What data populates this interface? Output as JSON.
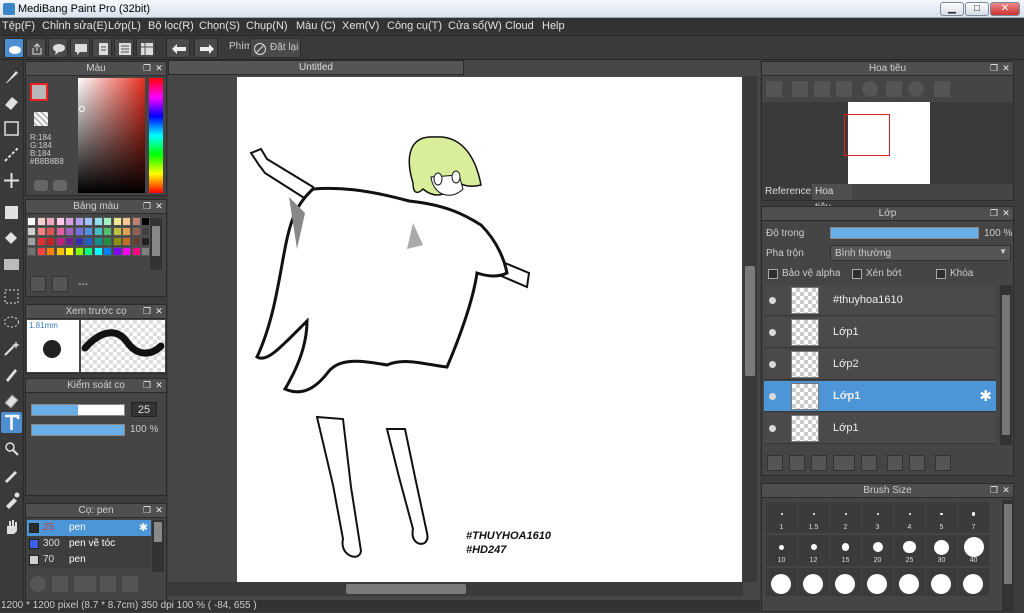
{
  "app": {
    "title": "MediBang Paint Pro (32bit)"
  },
  "window_controls": {
    "minimize": "▁",
    "maximize": "□",
    "close": "✕"
  },
  "menu": [
    "Tệp(F)",
    "Chỉnh sửa(E)",
    "Lớp(L)",
    "Bộ lọc(R)",
    "Chọn(S)",
    "Chụp(N)",
    "Màu (C)",
    "Xem(V)",
    "Công cụ(T)",
    "Cửa sổ(W)",
    "Cloud",
    "Help"
  ],
  "toolbar": {
    "shortcut_label": "Phím",
    "reset_label": "Đặt lại"
  },
  "color_panel": {
    "title": "Màu",
    "r": "R:184",
    "g": "G:184",
    "b": "B:184",
    "hex": "#B8B8B8",
    "primary_color": "#b8b8b8"
  },
  "palette_panel": {
    "title": "Bảng màu",
    "footer_text": "---",
    "colors": [
      "#ffffff",
      "#f6d0d0",
      "#f0a8c0",
      "#ffc8e8",
      "#d8a0e0",
      "#b0a0f0",
      "#a0c0ff",
      "#90e0f0",
      "#a0f0c0",
      "#f0e890",
      "#f8c890",
      "#c08070",
      "#000000",
      "#d0d0d0",
      "#f08080",
      "#e05050",
      "#e060a0",
      "#a060c0",
      "#7070e0",
      "#5090e0",
      "#40c0c0",
      "#50c070",
      "#c0c040",
      "#e0a050",
      "#906050",
      "#404040",
      "#a0a0a0",
      "#e03030",
      "#c02020",
      "#c02080",
      "#702090",
      "#3030b0",
      "#2060c0",
      "#109090",
      "#209040",
      "#909010",
      "#c07020",
      "#604030",
      "#202020",
      "#707070",
      "#ff4040",
      "#ff8000",
      "#ffc000",
      "#ffff00",
      "#80ff00",
      "#00ff80",
      "#00ffff",
      "#0080ff",
      "#8000ff",
      "#ff00ff",
      "#ff0080",
      "#808080"
    ]
  },
  "brush_preview": {
    "title": "Xem trước cọ",
    "size": "1.81mm"
  },
  "brush_control": {
    "title": "Kiểm soát cọ",
    "size_value": "25",
    "opacity_value": "100 %",
    "size_fraction": 0.5,
    "opacity_fraction": 1.0
  },
  "brush_list": {
    "title": "Cọ: pen",
    "items": [
      {
        "size": "25",
        "name": "pen",
        "color": "#2b2b2b",
        "selected": true
      },
      {
        "size": "300",
        "name": "pen vẽ tóc",
        "color": "#3a5ee8",
        "selected": false
      },
      {
        "size": "70",
        "name": "pen",
        "color": "#cfcfcf",
        "selected": false
      }
    ]
  },
  "canvas": {
    "tab_title": "Untitled",
    "watermark_line1": "#THUYHOA1610",
    "watermark_line2": "#HD247"
  },
  "status_bar": {
    "text": "1200 * 1200 pixel  (8.7 * 8.7cm)  350 dpi  100 %  ( -84, 655 )"
  },
  "navigator": {
    "title": "Hoa tiêu",
    "tabs": [
      "Reference",
      "Hoa tiêu"
    ]
  },
  "layer_panel": {
    "title": "Lớp",
    "opacity_label": "Độ trong",
    "opacity_value": "100 %",
    "opacity_fraction": 1.0,
    "blend_label": "Pha trộn",
    "blend_value": "Bình thường",
    "protect_alpha": "Bảo vệ alpha",
    "clipping": "Xén bớt",
    "lock": "Khóa",
    "layers": [
      {
        "name": "#thuyhoa1610",
        "selected": false
      },
      {
        "name": "Lớp1",
        "selected": false
      },
      {
        "name": "Lớp2",
        "selected": false
      },
      {
        "name": "Lớp1",
        "selected": true
      },
      {
        "name": "Lớp1",
        "selected": false
      }
    ]
  },
  "brush_size_panel": {
    "title": "Brush Size",
    "row1": [
      "1",
      "1.5",
      "2",
      "3",
      "4",
      "5",
      "7"
    ],
    "row2": [
      "10",
      "12",
      "15",
      "20",
      "25",
      "30",
      "40"
    ]
  },
  "colors": {
    "accent": "#4c96d7",
    "panel_bg": "#454545",
    "canvas_bg": "#ffffff"
  }
}
